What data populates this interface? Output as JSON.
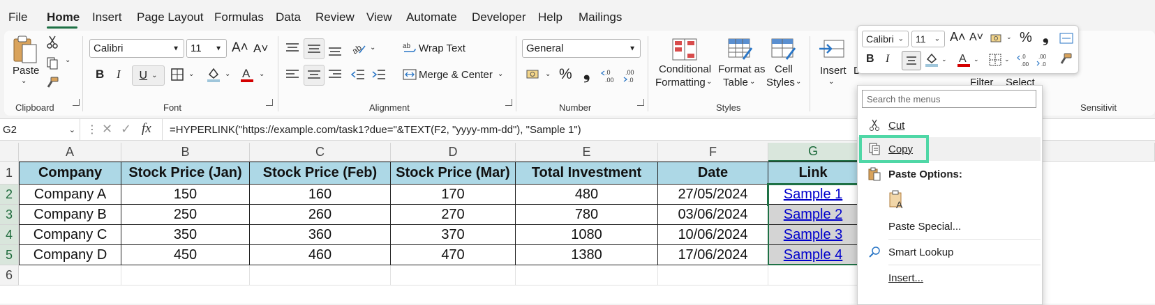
{
  "menu": {
    "items": [
      "File",
      "Home",
      "Insert",
      "Page Layout",
      "Formulas",
      "Data",
      "Review",
      "View",
      "Automate",
      "Developer",
      "Help",
      "Mailings"
    ],
    "active": "Home"
  },
  "clipboard": {
    "paste": "Paste",
    "group": "Clipboard"
  },
  "font": {
    "name": "Calibri",
    "size": "11",
    "bold": "B",
    "italic": "I",
    "underline": "U",
    "grow": "A˄",
    "shrink": "A˅",
    "group": "Font"
  },
  "alignment": {
    "wrap": "Wrap Text",
    "merge": "Merge & Center",
    "group": "Alignment"
  },
  "number": {
    "format": "General",
    "percent": "%",
    "comma": "̹",
    "inc": ".00",
    "dec": ".00",
    "group": "Number"
  },
  "styles": {
    "conditional_1": "Conditional",
    "conditional_2": "Formatting",
    "format_table_1": "Format as",
    "format_table_2": "Table",
    "cell_styles_1": "Cell",
    "cell_styles_2": "Styles",
    "group": "Styles"
  },
  "cells": {
    "insert": "Insert",
    "delete": "Delete",
    "filter": "Filter",
    "select": "Select",
    "sensitivity": "Sensitivit"
  },
  "formula_bar": {
    "namebox": "G2",
    "fx": "fx",
    "formula": "=HYPERLINK(\"https://example.com/task1?due=\"&TEXT(F2, \"yyyy-mm-dd\"), \"Sample 1\")"
  },
  "sheet": {
    "columns": [
      "A",
      "B",
      "C",
      "D",
      "E",
      "F",
      "G"
    ],
    "rows": [
      "1",
      "2",
      "3",
      "4",
      "5",
      "6"
    ],
    "header": [
      "Company",
      "Stock Price (Jan)",
      "Stock Price (Feb)",
      "Stock Price (Mar)",
      "Total Investment",
      "Date",
      "Link"
    ],
    "data": [
      [
        "Company A",
        "150",
        "160",
        "170",
        "480",
        "27/05/2024",
        "Sample 1"
      ],
      [
        "Company B",
        "250",
        "260",
        "270",
        "780",
        "03/06/2024",
        "Sample 2"
      ],
      [
        "Company C",
        "350",
        "360",
        "370",
        "1080",
        "10/06/2024",
        "Sample 3"
      ],
      [
        "Company D",
        "450",
        "460",
        "470",
        "1380",
        "17/06/2024",
        "Sample 4"
      ]
    ]
  },
  "mini_toolbar": {
    "font": "Calibri",
    "size": "11",
    "bold": "B",
    "italic": "I",
    "percent": "%"
  },
  "context_menu": {
    "search_placeholder": "Search the menus",
    "cut": "Cut",
    "copy": "Copy",
    "paste_options": "Paste Options:",
    "paste_special": "Paste Special...",
    "smart_lookup": "Smart Lookup",
    "insert": "Insert..."
  },
  "colors": {
    "accent": "#1e7145",
    "header_fill": "#add8e6",
    "link": "#0000cc",
    "highlight": "#4fd7a6"
  }
}
